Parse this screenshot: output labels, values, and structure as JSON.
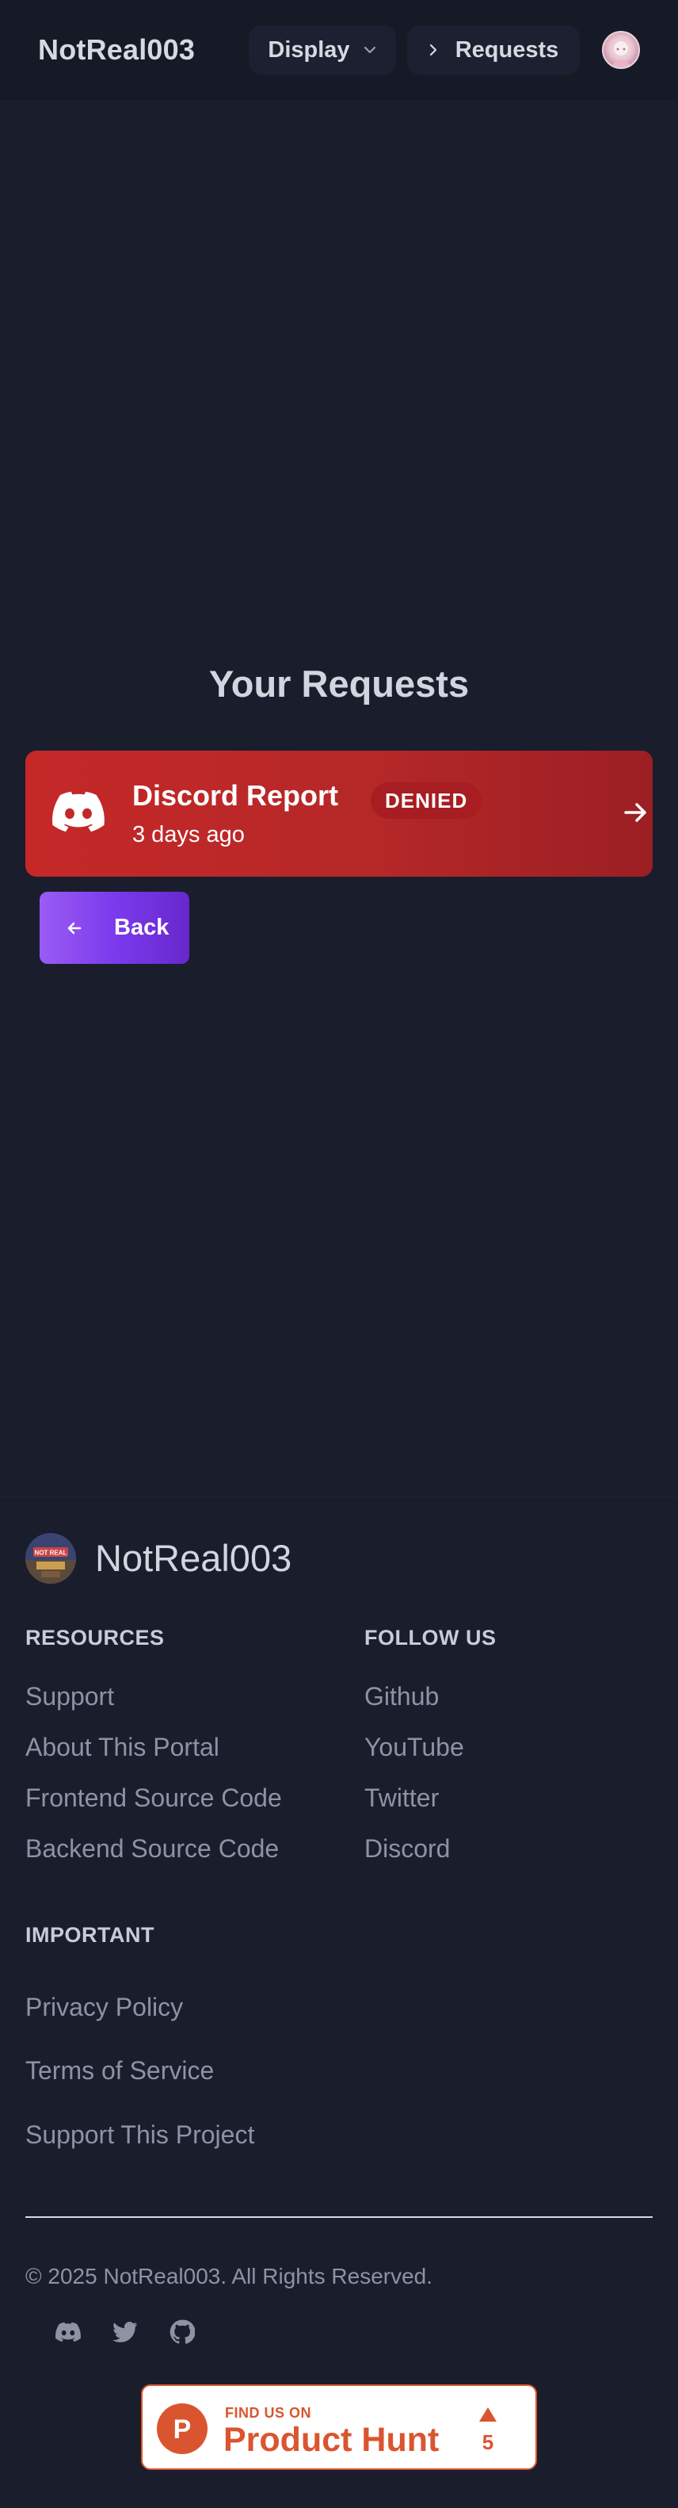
{
  "navbar": {
    "brand": "NotReal003",
    "display_label": "Display",
    "requests_label": "Requests",
    "avatar_icon": "user-avatar"
  },
  "main": {
    "title": "Your Requests",
    "requests": [
      {
        "icon": "discord-icon",
        "title": "Discord Report",
        "status": "DENIED",
        "time": "3 days ago",
        "status_color": "#c62828"
      }
    ],
    "back_label": "Back"
  },
  "footer": {
    "brand": "NotReal003",
    "logo_text": "NOT REAL",
    "resources": {
      "heading": "RESOURCES",
      "links": [
        "Support",
        "About This Portal",
        "Frontend Source Code",
        "Backend Source Code"
      ]
    },
    "follow": {
      "heading": "FOLLOW US",
      "links": [
        "Github",
        "YouTube",
        "Twitter",
        "Discord"
      ]
    },
    "important": {
      "heading": "IMPORTANT",
      "links": [
        "Privacy Policy",
        "Terms of Service",
        "Support This Project"
      ]
    },
    "copyright": "© 2025 NotReal003. All Rights Reserved.",
    "social_icons": [
      "discord-icon",
      "twitter-icon",
      "github-icon"
    ],
    "product_hunt": {
      "small": "FIND US ON",
      "big": "Product Hunt",
      "letter": "P",
      "count": "5"
    }
  },
  "colors": {
    "background": "#1a1d2c",
    "navbar": "#161a27",
    "denied": "#c62828",
    "back_button": "#7c3aed",
    "product_hunt": "#da552f"
  }
}
